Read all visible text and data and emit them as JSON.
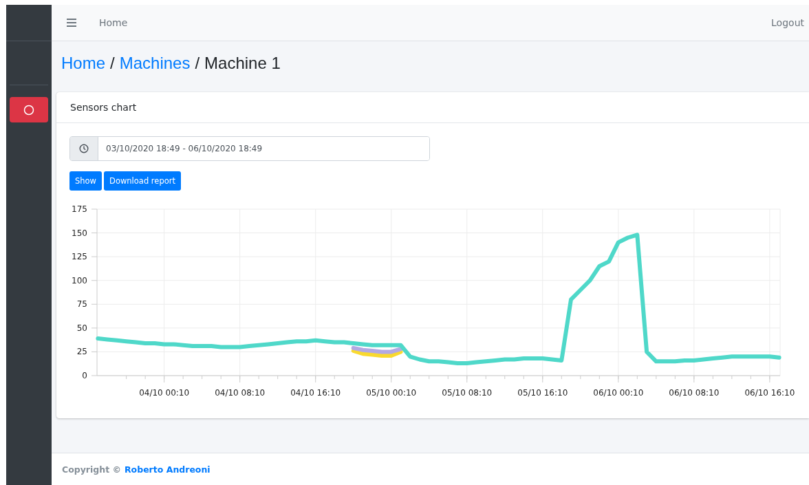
{
  "topbar": {
    "home_link": "Home",
    "logout_link": "Logout"
  },
  "breadcrumb": {
    "separator": "/",
    "items": [
      {
        "label": "Home",
        "link": true
      },
      {
        "label": "Machines",
        "link": true
      },
      {
        "label": "Machine 1",
        "link": false
      }
    ]
  },
  "card": {
    "title": "Sensors chart",
    "date_range": "03/10/2020 18:49 - 06/10/2020 18:49",
    "buttons": [
      "Show",
      "Download report"
    ],
    "chart_data": {
      "type": "line",
      "categories": [
        null,
        null,
        null,
        null,
        null,
        null,
        null,
        "04/10 00:10",
        null,
        null,
        null,
        null,
        null,
        null,
        null,
        "04/10 08:10",
        null,
        null,
        null,
        null,
        null,
        null,
        null,
        "04/10 16:10",
        null,
        null,
        null,
        null,
        null,
        null,
        null,
        "05/10 00:10",
        null,
        null,
        null,
        null,
        null,
        null,
        null,
        "05/10 08:10",
        null,
        null,
        null,
        null,
        null,
        null,
        null,
        "05/10 16:10",
        null,
        null,
        null,
        null,
        null,
        null,
        null,
        "06/10 00:10",
        null,
        null,
        null,
        null,
        null,
        null,
        null,
        "06/10 08:10",
        null,
        null,
        null,
        null,
        null,
        null,
        null,
        "06/10 16:10",
        null
      ],
      "series": [
        {
          "color": "#f9d92f",
          "values": [
            null,
            null,
            null,
            null,
            null,
            null,
            null,
            null,
            null,
            null,
            null,
            null,
            null,
            null,
            null,
            null,
            null,
            null,
            null,
            null,
            null,
            null,
            null,
            null,
            null,
            null,
            null,
            26,
            23,
            22,
            21,
            21,
            25,
            null,
            null,
            null,
            null,
            null,
            null,
            null,
            null,
            null,
            null,
            null,
            null,
            null,
            null,
            null,
            null,
            null,
            null,
            null,
            null,
            null,
            null,
            null,
            null,
            null,
            null,
            null,
            null,
            null,
            null,
            null,
            null,
            null,
            null,
            null,
            null,
            null,
            null,
            null,
            null
          ]
        },
        {
          "color": "#b3a9e3",
          "values": [
            null,
            null,
            null,
            null,
            null,
            null,
            null,
            null,
            null,
            null,
            null,
            null,
            null,
            null,
            null,
            null,
            null,
            null,
            null,
            null,
            null,
            null,
            null,
            null,
            null,
            null,
            null,
            29,
            27,
            26,
            25,
            25,
            28,
            null,
            null,
            null,
            null,
            null,
            null,
            null,
            null,
            null,
            null,
            null,
            null,
            null,
            null,
            null,
            null,
            null,
            null,
            null,
            null,
            null,
            null,
            null,
            null,
            null,
            null,
            null,
            null,
            null,
            null,
            null,
            null,
            null,
            null,
            null,
            null,
            null,
            null,
            null,
            null
          ]
        },
        {
          "color": "#4fd8c9",
          "values": [
            39,
            38,
            37,
            36,
            35,
            34,
            34,
            33,
            33,
            32,
            31,
            31,
            31,
            30,
            30,
            30,
            31,
            32,
            33,
            34,
            35,
            36,
            36,
            37,
            36,
            35,
            35,
            34,
            33,
            32,
            32,
            32,
            32,
            20,
            17,
            15,
            15,
            14,
            13,
            13,
            14,
            15,
            16,
            17,
            17,
            18,
            18,
            18,
            17,
            16,
            80,
            90,
            100,
            115,
            120,
            140,
            145,
            148,
            25,
            15,
            15,
            15,
            16,
            16,
            17,
            18,
            19,
            20,
            20,
            20,
            20,
            20,
            19
          ]
        }
      ],
      "ylim": [
        0,
        175
      ],
      "grid": true,
      "yticks": [
        0,
        25,
        50,
        75,
        100,
        125,
        150,
        175
      ]
    }
  },
  "footer": {
    "prefix": "Copyright ©",
    "author": "Roberto Andreoni"
  }
}
